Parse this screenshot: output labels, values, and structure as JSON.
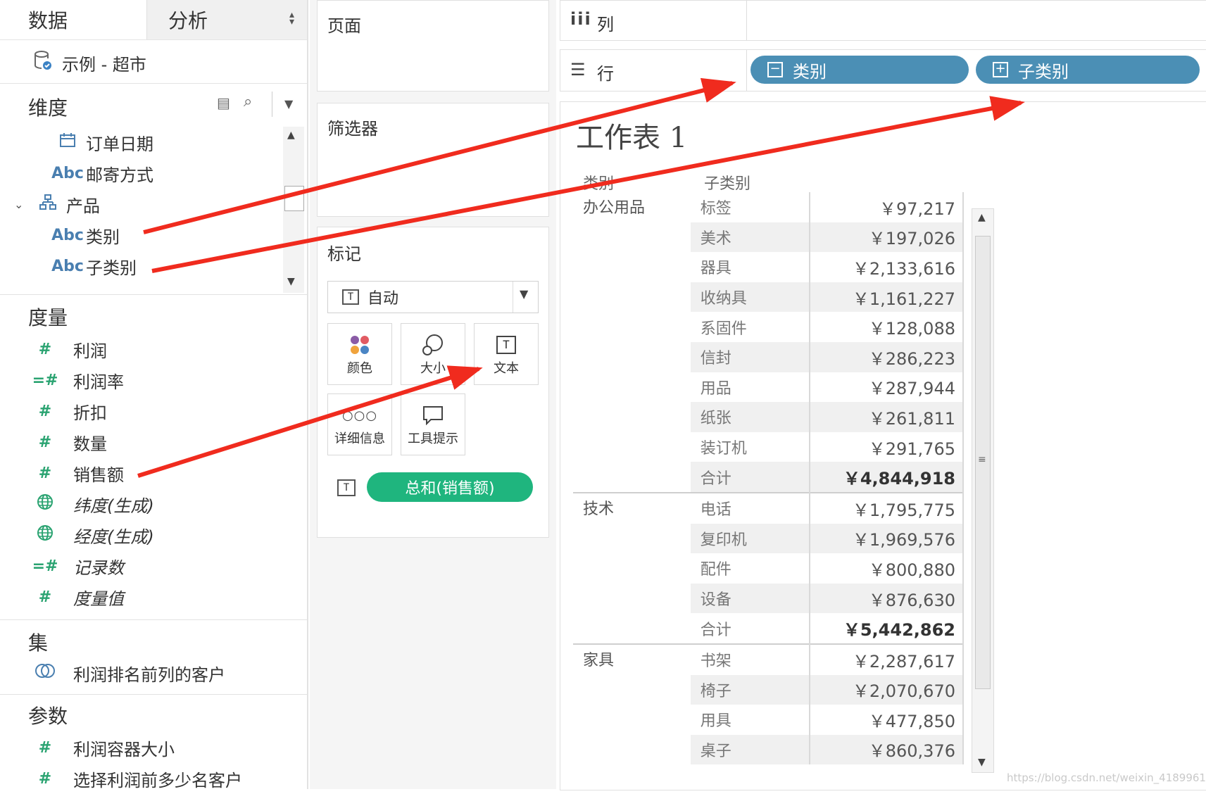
{
  "tabs": {
    "data": "数据",
    "analysis": "分析"
  },
  "data_source": "示例 - 超市",
  "dimensions": {
    "title": "维度",
    "items": [
      {
        "icon": "calendar-icon",
        "label": "订单日期"
      },
      {
        "icon": "abc-icon",
        "icon_text": "Abc",
        "label": "邮寄方式"
      },
      {
        "icon": "hierarchy-icon",
        "label": "产品"
      },
      {
        "icon": "abc-icon",
        "icon_text": "Abc",
        "label": "类别"
      },
      {
        "icon": "abc-icon",
        "icon_text": "Abc",
        "label": "子类别"
      }
    ]
  },
  "measures": {
    "title": "度量",
    "items": [
      {
        "icon_text": "#",
        "label": "利润"
      },
      {
        "icon_text": "=#",
        "label": "利润率"
      },
      {
        "icon_text": "#",
        "label": "折扣"
      },
      {
        "icon_text": "#",
        "label": "数量"
      },
      {
        "icon_text": "#",
        "label": "销售额"
      },
      {
        "icon": "globe-icon",
        "label": "纬度(生成)"
      },
      {
        "icon": "globe-icon",
        "label": "经度(生成)"
      },
      {
        "icon_text": "=#",
        "label": "记录数"
      },
      {
        "icon_text": "#",
        "label": "度量值"
      }
    ]
  },
  "sets": {
    "title": "集",
    "items": [
      {
        "icon": "set-icon",
        "label": "利润排名前列的客户"
      }
    ]
  },
  "parameters": {
    "title": "参数",
    "items": [
      {
        "icon_text": "#",
        "label": "利润容器大小"
      },
      {
        "icon_text": "#",
        "label": "选择利润前多少名客户"
      }
    ]
  },
  "cards": {
    "pages": "页面",
    "filters": "筛选器",
    "marks": "标记",
    "mark_type": "自动",
    "buttons": {
      "color": "颜色",
      "size": "大小",
      "text": "文本",
      "detail": "详细信息",
      "tooltip": "工具提示"
    },
    "text_pill": "总和(销售额)"
  },
  "shelves": {
    "columns_label": "列",
    "rows_label": "行",
    "rows_pills": [
      "类别",
      "子类别"
    ]
  },
  "worksheet": {
    "title": "工作表 1",
    "col_headers": {
      "category": "类别",
      "subcategory": "子类别"
    },
    "groups": [
      {
        "name": "办公用品",
        "rows": [
          {
            "sub": "标签",
            "value": "￥97,217"
          },
          {
            "sub": "美术",
            "value": "￥197,026"
          },
          {
            "sub": "器具",
            "value": "￥2,133,616"
          },
          {
            "sub": "收纳具",
            "value": "￥1,161,227"
          },
          {
            "sub": "系固件",
            "value": "￥128,088"
          },
          {
            "sub": "信封",
            "value": "￥286,223"
          },
          {
            "sub": "用品",
            "value": "￥287,944"
          },
          {
            "sub": "纸张",
            "value": "￥261,811"
          },
          {
            "sub": "装订机",
            "value": "￥291,765"
          },
          {
            "sub": "合计",
            "value": "￥4,844,918",
            "total": true
          }
        ]
      },
      {
        "name": "技术",
        "rows": [
          {
            "sub": "电话",
            "value": "￥1,795,775"
          },
          {
            "sub": "复印机",
            "value": "￥1,969,576"
          },
          {
            "sub": "配件",
            "value": "￥800,880"
          },
          {
            "sub": "设备",
            "value": "￥876,630"
          },
          {
            "sub": "合计",
            "value": "￥5,442,862",
            "total": true
          }
        ]
      },
      {
        "name": "家具",
        "rows": [
          {
            "sub": "书架",
            "value": "￥2,287,617"
          },
          {
            "sub": "椅子",
            "value": "￥2,070,670"
          },
          {
            "sub": "用具",
            "value": "￥477,850"
          },
          {
            "sub": "桌子",
            "value": "￥860,376"
          }
        ]
      }
    ]
  },
  "watermark": "https://blog.csdn.net/weixin_41899611",
  "colors": {
    "pill_blue": "#4b8fb5",
    "pill_green": "#1fb57e",
    "arrow_red": "#f02b1e",
    "hash_green": "#2aa371"
  }
}
